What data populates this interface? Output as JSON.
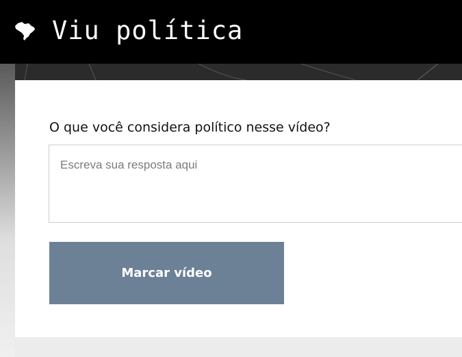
{
  "header": {
    "title": "Viu política",
    "logo_icon": "brazil-map-icon",
    "background": "#000000"
  },
  "form": {
    "question": "O que você considera político nesse vídeo?",
    "answer_placeholder": "Escreva sua resposta aqui",
    "answer_value": "",
    "submit_label": "Marcar vídeo",
    "submit_color": "#6c8196"
  }
}
